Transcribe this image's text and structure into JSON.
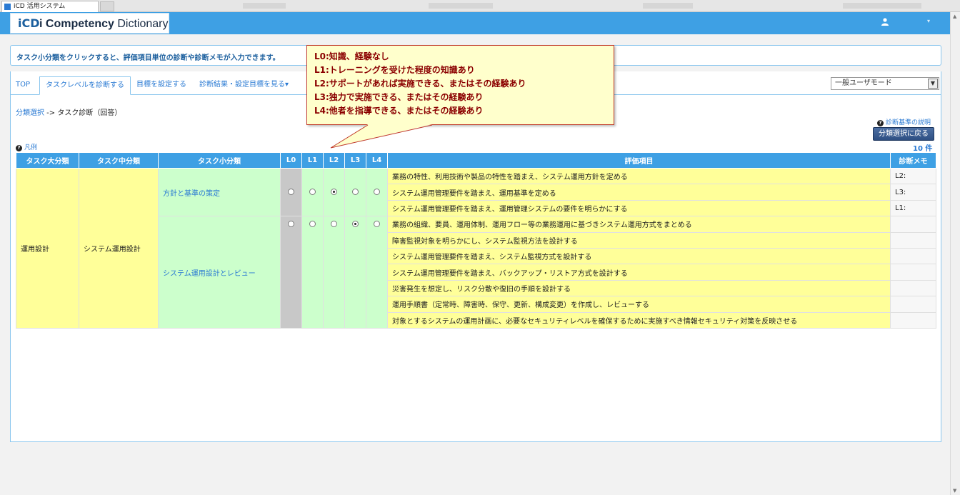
{
  "window": {
    "tab_title": "iCD 活用システム"
  },
  "header": {
    "logo_mark": "iCD",
    "logo_text_bold": "i Competency",
    "logo_text_rest": " Dictionary",
    "user_icon": "user-icon",
    "caret": "▾"
  },
  "info": {
    "message": "タスク小分類をクリックすると、評価項目単位の診断や診断メモが入力できます。"
  },
  "tabs": [
    {
      "label": "TOP"
    },
    {
      "label": "タスクレベルを診断する"
    },
    {
      "label": "目標を設定する"
    },
    {
      "label": "診断結果・設定目標を見る▾"
    }
  ],
  "mode_select": {
    "value": "一般ユーザモード"
  },
  "breadcrumb": {
    "link": "分類選択",
    "arrow": " -> ",
    "current": "タスク診断（回答）"
  },
  "help_link": "診断基準の説明",
  "back_button": "分類選択に戻る",
  "count": "10 件",
  "legend": "凡例",
  "table": {
    "headers": {
      "large": "タスク大分類",
      "mid": "タスク中分類",
      "small": "タスク小分類",
      "l0": "L0",
      "l1": "L1",
      "l2": "L2",
      "l3": "L3",
      "l4": "L4",
      "item": "評価項目",
      "memo": "診断メモ"
    },
    "large": "運用設計",
    "mid": "システム運用設計",
    "groups": [
      {
        "small": "方針と基準の策定",
        "selected_level": 2,
        "items": [
          {
            "text": "業務の特性、利用技術や製品の特性を踏まえ、システム運用方針を定める",
            "memo": "L2:"
          },
          {
            "text": "システム運用管理要件を踏まえ、運用基準を定める",
            "memo": "L3:"
          },
          {
            "text": "システム運用管理要件を踏まえ、運用管理システムの要件を明らかにする",
            "memo": "L1:"
          }
        ]
      },
      {
        "small": "システム運用設計とレビュー",
        "selected_level": 3,
        "items": [
          {
            "text": "業務の組織、要員、運用体制、運用フロー等の業務運用に基づきシステム運用方式をまとめる",
            "memo": ""
          },
          {
            "text": "障害監視対象を明らかにし、システム監視方法を設計する",
            "memo": ""
          },
          {
            "text": "システム運用管理要件を踏まえ、システム監視方式を設計する",
            "memo": ""
          },
          {
            "text": "システム運用管理要件を踏まえ、バックアップ・リストア方式を設計する",
            "memo": ""
          },
          {
            "text": "災害発生を想定し、リスク分散や復旧の手順を設計する",
            "memo": ""
          },
          {
            "text": "運用手順書（定常時、障害時、保守、更新、構成変更）を作成し、レビューする",
            "memo": ""
          },
          {
            "text": "対象とするシステムの運用計画に、必要なセキュリティレベルを確保するために実施すべき情報セキュリティ対策を反映させる",
            "memo": ""
          }
        ]
      }
    ]
  },
  "callout": {
    "lines": [
      "L0:知識、経験なし",
      "L1:トレーニングを受けた程度の知識あり",
      "L2:サポートがあれば実施できる、またはその経験あり",
      "L3:独力で実施できる、またはその経験あり",
      "L4:他者を指導できる、またはその経験あり"
    ]
  }
}
